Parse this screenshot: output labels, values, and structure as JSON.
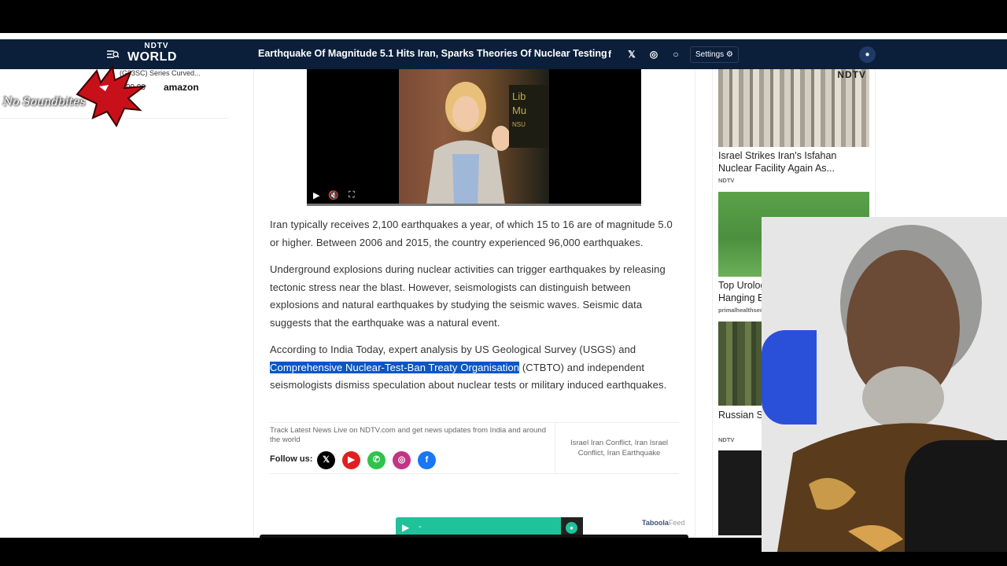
{
  "nav": {
    "logo_top": "NDTV",
    "logo_bottom": "WORLD",
    "title": "Earthquake Of Magnitude 5.1 Hits Iran, Sparks Theories Of Nuclear Testing",
    "settings_label": "Settings",
    "share_icons": [
      "facebook-icon",
      "x-icon",
      "whatsapp-icon",
      "comment-icon"
    ]
  },
  "left_ad": {
    "product_text": "(G93SC) Series Curved...",
    "price": "99.99",
    "brand": "amazon"
  },
  "watermark": "No Soundbites",
  "video": {
    "sign_text_1": "Lib",
    "sign_text_2": "Mu",
    "sign_text_3": "NSU"
  },
  "article": {
    "p1": "Iran typically receives 2,100 earthquakes a year, of which 15 to 16 are of magnitude 5.0 or higher. Between 2006 and 2015, the country experienced 96,000 earthquakes.",
    "p2": "Underground explosions during nuclear activities can trigger earthquakes by releasing tectonic stress near the blast. However, seismologists can distinguish between explosions and natural earthquakes by studying the seismic waves. Seismic data suggests that the earthquake was a natural event.",
    "p3_before": "According to India Today, expert analysis by US Geological Survey (USGS) and ",
    "p3_highlight": "Comprehensive Nuclear-Test-Ban Treaty Organisation",
    "p3_after": " (CTBTO) and independent seismologists dismiss speculation about nuclear tests or military induced earthquakes."
  },
  "footer": {
    "track_text": "Track Latest News Live on NDTV.com and get news updates from India and around the world",
    "follow_label": "Follow us:",
    "tags": "Israel Iran Conflict, Iran Israel Conflict, Iran Earthquake"
  },
  "player": {
    "dash": "-",
    "taboola": "Taboola",
    "taboola_feed": "Feed"
  },
  "sidebar": {
    "cards": [
      {
        "title": "Israel Strikes Iran's Isfahan Nuclear Facility Again As...",
        "source": "NDTV",
        "brand": "NDTV"
      },
      {
        "title": "Top Urologist: How To R... A Hanging Belly Quickly",
        "source": "primalhealthsecrets | Sponsored Link"
      },
      {
        "title": "Russian S... Killing An...",
        "source": "NDTV"
      }
    ]
  }
}
